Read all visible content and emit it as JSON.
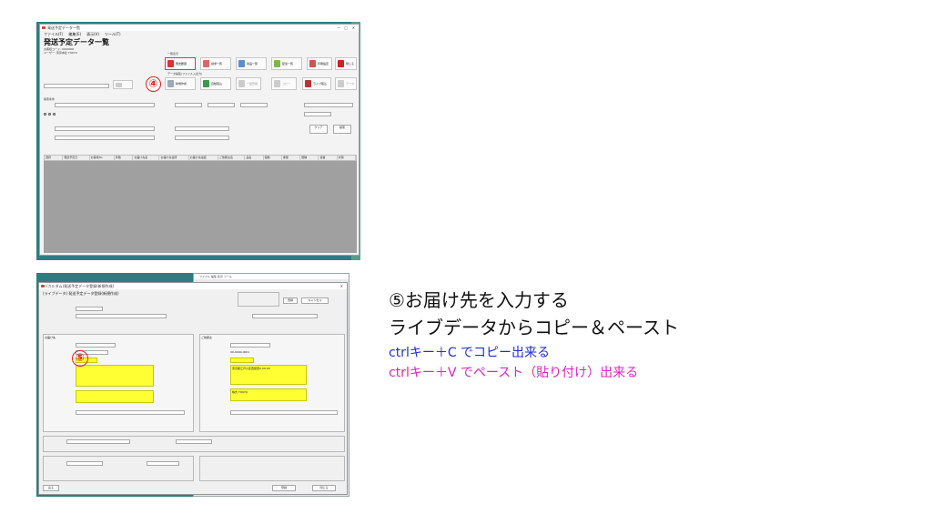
{
  "top_window": {
    "title": "発送予定データ一覧",
    "menu": [
      "ファイル(F)",
      "編集(E)",
      "表示(V)",
      "ツール(T)"
    ],
    "heading": "発送予定データ一覧",
    "sub_info": [
      "お客様コード: 0000000",
      "ユーザー: 東京本社 TOKYO"
    ],
    "group_label_1": "一覧表示",
    "group_label_2": "データ編集(ファイル入出力)",
    "toolbar_row1": [
      "発送履歴",
      "請求一覧",
      "商品一覧",
      "配達一覧",
      "印刷設定",
      "閉じる"
    ],
    "toolbar_row2": [
      "新規作成",
      "自動取込",
      "一括登録",
      "コピー",
      "ライブ取込",
      "データ"
    ],
    "circled_number": "④",
    "filter_label": "検索条件",
    "search_button": "検索",
    "clear_button": "クリア",
    "grid_columns": [
      "選択",
      "発送予定日",
      "お客様No",
      "件数",
      "お届け先名",
      "お届け先住所",
      "お届け先電話",
      "ご依頼主名",
      "品名",
      "個数",
      "重量",
      "便種",
      "運賃",
      "状態"
    ]
  },
  "bottom_window": {
    "back_title": "ファイル  編集  表示  ツール",
    "front_title": "(カルダム)発送予定データ登録(新規作成)",
    "header_label": "(ライブデータ) 発送予定データ登録(新規作成)",
    "circled_number": "⑤",
    "left_section": "お届け先",
    "right_section": "ご依頼主",
    "right_code": "00-0000-0001",
    "right_address_line": "東京都江戸川区西葛西0-00-00",
    "right_name": "株式 TOKYO",
    "register_button": "登録",
    "cancel_button": "キャンセル",
    "footer_buttons": [
      "戻る",
      "登録",
      "閉じる"
    ]
  },
  "instructions": {
    "step": "⑤お届け先を入力する",
    "line2": "ライブデータからコピー＆ペースト",
    "copy_hint": "ctrlキー＋C でコピー出来る",
    "paste_hint": "ctrlキー＋V でペースト（貼り付け）出来る"
  },
  "colors": {
    "copy_hint": "#1f2fd6",
    "paste_hint": "#e022c4",
    "circle": "#e0201c",
    "highlight": "#ffff33"
  }
}
